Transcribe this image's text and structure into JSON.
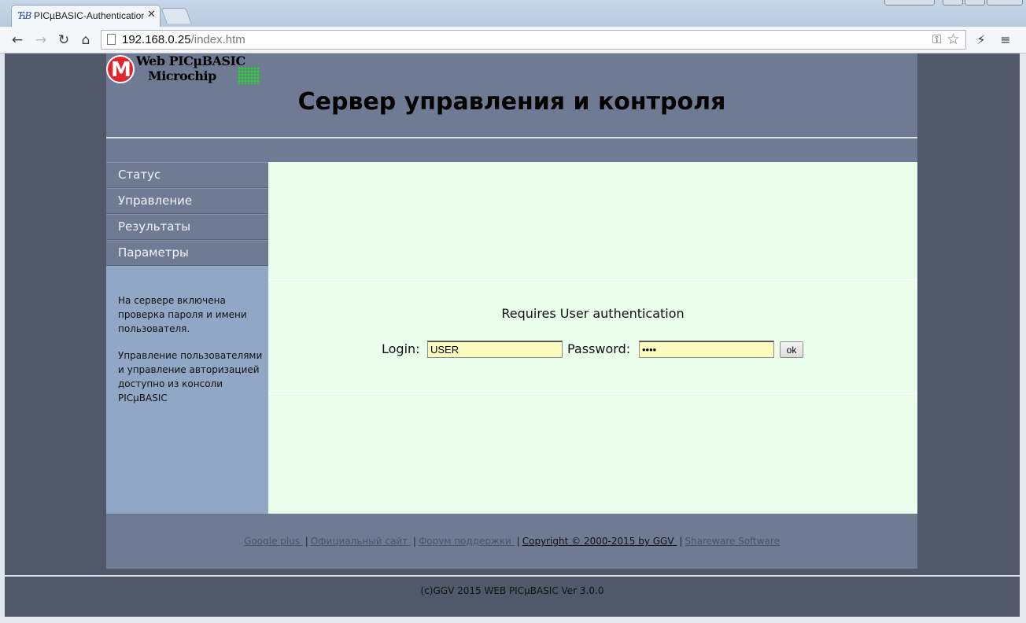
{
  "browser": {
    "tab_title": "PICµBASIC-Authentication",
    "tab_favicon": "ЋB",
    "url_host": "192.168.0.25",
    "url_path": "/index.htm"
  },
  "header": {
    "logo_line1": "Web PICµBASIC",
    "logo_line2": "Microchip",
    "title": "Сервер управления и контроля"
  },
  "sidebar": {
    "items": [
      {
        "label": "Статус"
      },
      {
        "label": "Управление"
      },
      {
        "label": "Результаты"
      },
      {
        "label": "Параметры"
      }
    ],
    "note1": "На сервере включена проверка пароля и имени пользователя.",
    "note2": "Управление пользователями и управление авторизацией доступно из консоли PICµBASIC"
  },
  "auth": {
    "title": "Requires User authentication",
    "login_label": "Login:",
    "login_value": "USER",
    "password_label": "Password:",
    "password_value": "••••",
    "ok_label": "ok"
  },
  "footer": {
    "links": [
      {
        "label": "Google plus "
      },
      {
        "label": "Официальный сайт "
      },
      {
        "label": "Форум поддержки "
      },
      {
        "label": "Copyright © 2000-2015 by GGV "
      },
      {
        "label": "Shareware Software"
      }
    ],
    "bottom_text": "(c)GGV 2015 WEB PICµBASIC Ver 3.0.0"
  },
  "colors": {
    "background": "#505869",
    "header": "#6f7b93",
    "sidebar": "#92a6c6",
    "content": "#ebfdeb",
    "input": "#fbfbbe",
    "logo_red": "#e0262d",
    "logo_green": "#18e018"
  }
}
